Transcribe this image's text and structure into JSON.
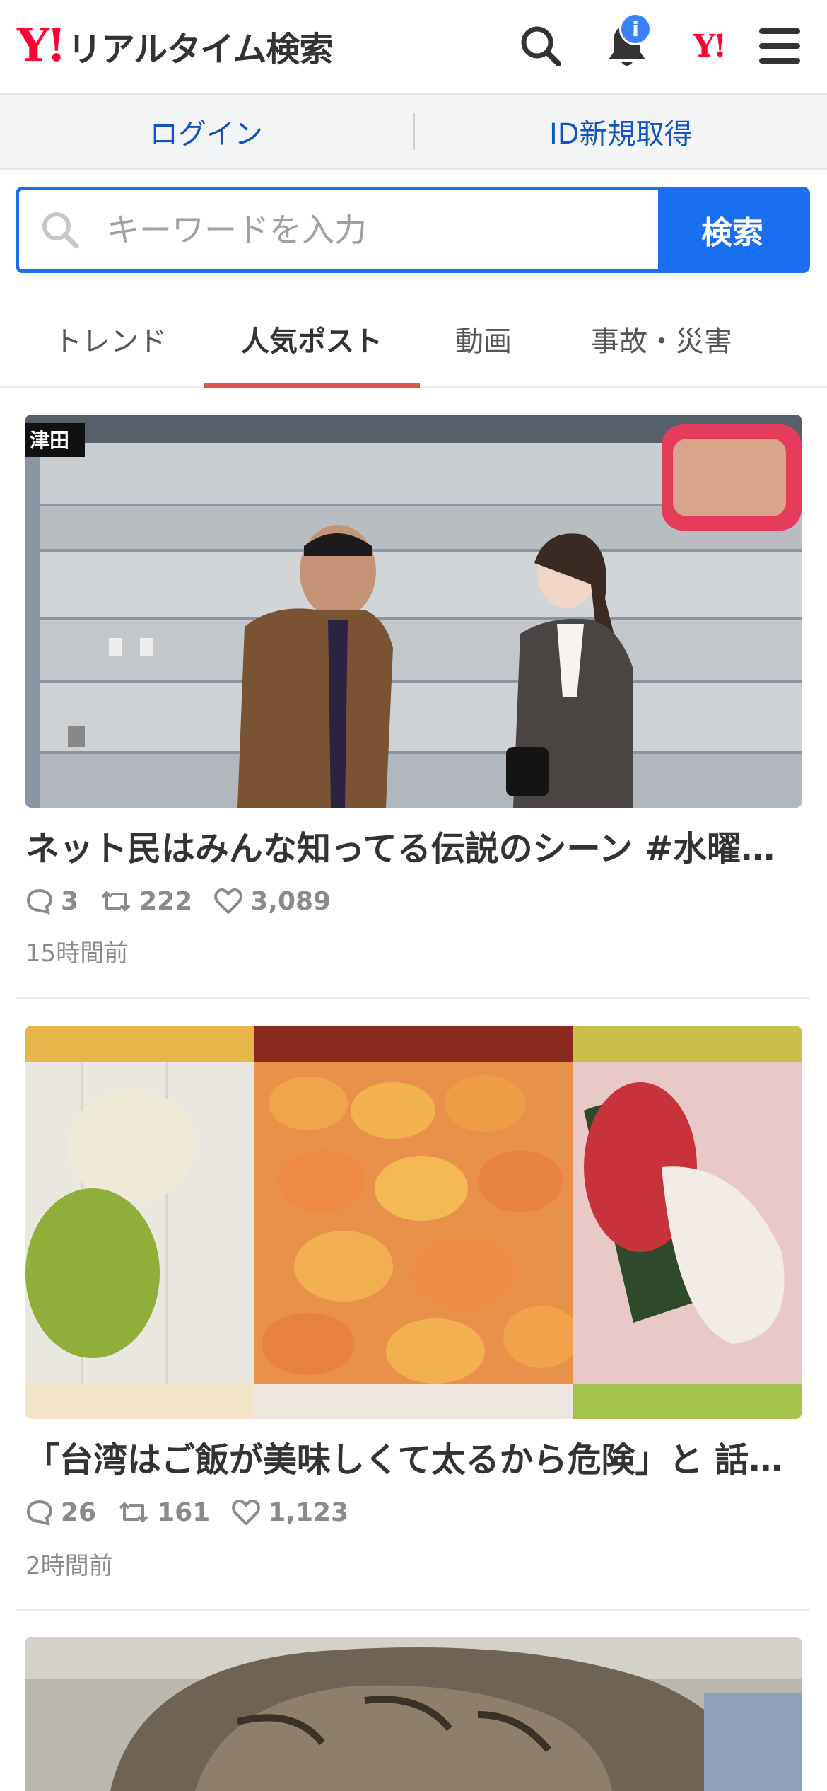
{
  "header": {
    "logo_mark": "Y!",
    "logo_text": "リアルタイム検索",
    "notification_badge": "i",
    "yahoo_mark": "Y!"
  },
  "account": {
    "login": "ログイン",
    "register": "ID新規取得"
  },
  "search": {
    "placeholder": "キーワードを入力",
    "button": "検索"
  },
  "tabs": [
    {
      "label": "トレンド",
      "active": false
    },
    {
      "label": "人気ポスト",
      "active": true
    },
    {
      "label": "動画",
      "active": false
    },
    {
      "label": "事故・災害",
      "active": false
    }
  ],
  "posts": [
    {
      "title": "ネット民はみんな知ってる伝説のシーン #水曜日のダウンタウン",
      "replies": "3",
      "reposts": "222",
      "likes": "3,089",
      "time": "15時間前",
      "image": "tv-scene"
    },
    {
      "title": "「台湾はご飯が美味しくて太るから危険」と 話題に",
      "replies": "26",
      "reposts": "161",
      "likes": "1,123",
      "time": "2時間前",
      "image": "tropical-fruits"
    },
    {
      "image": "cat"
    }
  ],
  "colors": {
    "brand_red": "#ff0033",
    "accent_blue": "#1a6ff1",
    "tab_underline": "#e0524a",
    "link_blue": "#1154c0"
  }
}
